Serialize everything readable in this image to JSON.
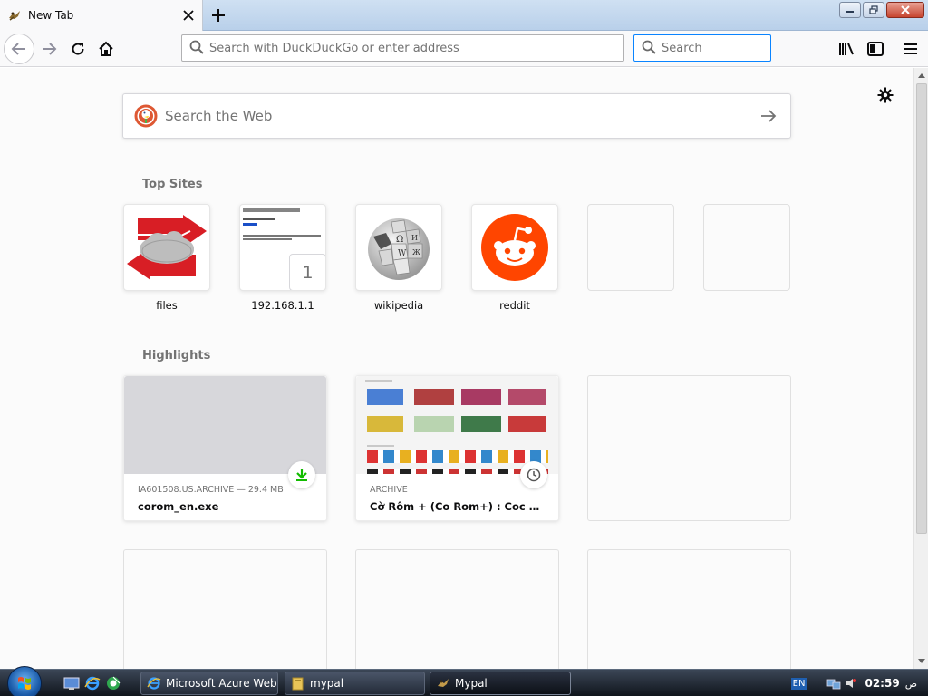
{
  "browser": {
    "tab_title": "New Tab",
    "url_placeholder": "Search with DuckDuckGo or enter address",
    "search_placeholder": "Search"
  },
  "newtab": {
    "web_search_placeholder": "Search the Web",
    "top_sites_title": "Top Sites",
    "top_sites": [
      {
        "label": "files",
        "icon": "cloud-sync-icon"
      },
      {
        "label": "192.168.1.1",
        "icon": "page-screenshot",
        "badge": "1"
      },
      {
        "label": "wikipedia",
        "icon": "wikipedia-globe-icon"
      },
      {
        "label": "reddit",
        "icon": "reddit-icon"
      },
      {
        "label": ""
      },
      {
        "label": ""
      }
    ],
    "highlights_title": "Highlights",
    "highlights": [
      {
        "source": "IA601508.US.ARCHIVE — 29.4 MB",
        "title": "corom_en.exe",
        "context_icon": "download-icon"
      },
      {
        "source": "ARCHIVE",
        "title": "Cờ Rôm + (Co Rom+) : Coc Coc : ...",
        "context_icon": "clock-icon"
      }
    ]
  },
  "taskbar": {
    "buttons": [
      {
        "label": "Microsoft Azure Web..."
      },
      {
        "label": "mypal"
      },
      {
        "label": "Mypal"
      }
    ],
    "language": "EN",
    "clock": "02:59",
    "am_pm": "ص"
  },
  "colors": {
    "accent_blue": "#0a84ff",
    "reddit_orange": "#ff4500",
    "download_green": "#12bc00",
    "files_red": "#d81e25"
  }
}
